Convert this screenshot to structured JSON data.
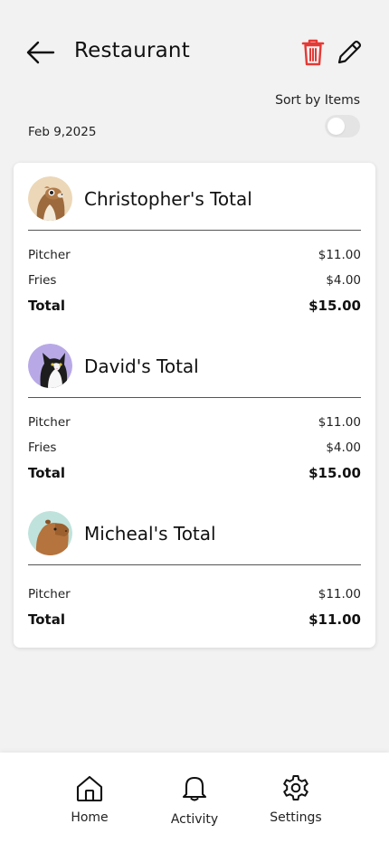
{
  "header": {
    "title": "Restaurant",
    "sort_label": "Sort by Items",
    "sort_enabled": false,
    "date": "Feb 9,2025",
    "delete_color": "#e53935"
  },
  "people": [
    {
      "name": "Christopher's Total",
      "avatar": "hamster-avatar",
      "items": [
        {
          "label": "Pitcher",
          "amount": "$11.00"
        },
        {
          "label": "Fries",
          "amount": "$4.00"
        }
      ],
      "total_label": "Total",
      "total_amount": "$15.00"
    },
    {
      "name": "David's Total",
      "avatar": "cat-avatar",
      "items": [
        {
          "label": "Pitcher",
          "amount": "$11.00"
        },
        {
          "label": "Fries",
          "amount": "$4.00"
        }
      ],
      "total_label": "Total",
      "total_amount": "$15.00"
    },
    {
      "name": "Micheal's Total",
      "avatar": "capybara-avatar",
      "items": [
        {
          "label": "Pitcher",
          "amount": "$11.00"
        }
      ],
      "total_label": "Total",
      "total_amount": "$11.00"
    }
  ],
  "nav": {
    "home": "Home",
    "activity": "Activity",
    "settings": "Settings"
  }
}
